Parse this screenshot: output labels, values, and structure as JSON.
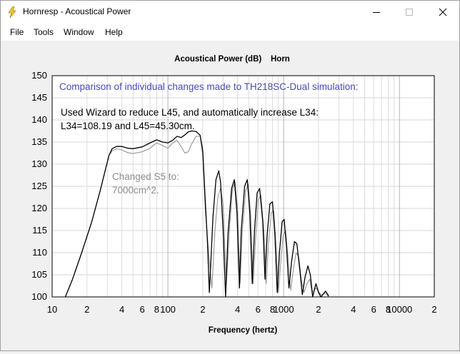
{
  "window": {
    "title": "Hornresp - Acoustical Power",
    "icon": "lightning-bolt-icon",
    "controls": [
      "minimize-icon",
      "maximize-icon",
      "close-icon"
    ]
  },
  "menu": {
    "items": [
      {
        "label": "File"
      },
      {
        "label": "Tools"
      },
      {
        "label": "Window"
      },
      {
        "label": "Help"
      }
    ]
  },
  "chart_data": {
    "type": "line",
    "title": "Acoustical Power (dB)    Horn",
    "xlabel": "Frequency (hertz)",
    "ylabel": "",
    "xscale": "log",
    "xlim": [
      10,
      20000
    ],
    "ylim": [
      100,
      150
    ],
    "grid": true,
    "x_tick_labels": [
      {
        "value": 10,
        "label": "10"
      },
      {
        "value": 20,
        "label": "2"
      },
      {
        "value": 40,
        "label": "4"
      },
      {
        "value": 60,
        "label": "6"
      },
      {
        "value": 80,
        "label": "8"
      },
      {
        "value": 100,
        "label": "100"
      },
      {
        "value": 200,
        "label": "2"
      },
      {
        "value": 400,
        "label": "4"
      },
      {
        "value": 600,
        "label": "6"
      },
      {
        "value": 800,
        "label": "8"
      },
      {
        "value": 1000,
        "label": "1000"
      },
      {
        "value": 2000,
        "label": "2"
      },
      {
        "value": 4000,
        "label": "4"
      },
      {
        "value": 6000,
        "label": "6"
      },
      {
        "value": 8000,
        "label": "8"
      },
      {
        "value": 10000,
        "label": "10000"
      },
      {
        "value": 20000,
        "label": "2"
      }
    ],
    "y_ticks": [
      100,
      105,
      110,
      115,
      120,
      125,
      130,
      135,
      140,
      145,
      150
    ],
    "annotations": {
      "heading": {
        "text": "Comparison of individual changes made to TH218SC-Dual simulation:",
        "color": "#4a4ab8"
      },
      "black_note": {
        "lines": [
          "Used Wizard to reduce L45, and automatically increase L34:",
          "L34=108.19 and L45=45.30cm."
        ],
        "color": "#000000"
      },
      "gray_note": {
        "lines": [
          "Changed S5 to:",
          "7000cm^2."
        ],
        "color": "#8c8c8c"
      }
    },
    "series": [
      {
        "color": "#000000",
        "points": [
          [
            13,
            100
          ],
          [
            15,
            104
          ],
          [
            18,
            110
          ],
          [
            22,
            117
          ],
          [
            26,
            124
          ],
          [
            29,
            129
          ],
          [
            31,
            132
          ],
          [
            33,
            133.5
          ],
          [
            36,
            134
          ],
          [
            40,
            134
          ],
          [
            45,
            133.6
          ],
          [
            50,
            133.5
          ],
          [
            60,
            133.9
          ],
          [
            70,
            134.8
          ],
          [
            80,
            135.5
          ],
          [
            90,
            135
          ],
          [
            100,
            134.8
          ],
          [
            110,
            135.4
          ],
          [
            120,
            136.3
          ],
          [
            130,
            136
          ],
          [
            140,
            136.6
          ],
          [
            150,
            137.3
          ],
          [
            160,
            137.5
          ],
          [
            175,
            137.4
          ],
          [
            190,
            136.5
          ],
          [
            200,
            133
          ],
          [
            210,
            122
          ],
          [
            220,
            112
          ],
          [
            228,
            101
          ],
          [
            235,
            108
          ],
          [
            245,
            118
          ],
          [
            260,
            126.5
          ],
          [
            275,
            128.5
          ],
          [
            285,
            126
          ],
          [
            300,
            115
          ],
          [
            315,
            100
          ],
          [
            330,
            114
          ],
          [
            355,
            124.5
          ],
          [
            375,
            126.5
          ],
          [
            395,
            119
          ],
          [
            415,
            102
          ],
          [
            430,
            115
          ],
          [
            460,
            125
          ],
          [
            485,
            126.5
          ],
          [
            510,
            119
          ],
          [
            535,
            103
          ],
          [
            560,
            115
          ],
          [
            590,
            123.5
          ],
          [
            620,
            124.5
          ],
          [
            660,
            117
          ],
          [
            690,
            104
          ],
          [
            720,
            114
          ],
          [
            760,
            121
          ],
          [
            800,
            121.5
          ],
          [
            840,
            114
          ],
          [
            880,
            101
          ],
          [
            920,
            110
          ],
          [
            970,
            117
          ],
          [
            1010,
            117.5
          ],
          [
            1060,
            111
          ],
          [
            1110,
            102
          ],
          [
            1170,
            108
          ],
          [
            1240,
            112.5
          ],
          [
            1300,
            112
          ],
          [
            1380,
            106
          ],
          [
            1450,
            100.5
          ],
          [
            1530,
            104.5
          ],
          [
            1620,
            107
          ],
          [
            1700,
            105
          ],
          [
            1780,
            100
          ],
          [
            1900,
            103
          ],
          [
            2000,
            101
          ],
          [
            2100,
            100
          ],
          [
            2300,
            101.3
          ],
          [
            2450,
            100.2
          ]
        ]
      },
      {
        "color": "#8c8c8c",
        "points": [
          [
            13,
            100
          ],
          [
            15,
            104
          ],
          [
            18,
            110
          ],
          [
            22,
            117
          ],
          [
            26,
            124
          ],
          [
            29,
            129
          ],
          [
            31,
            132
          ],
          [
            33,
            133
          ],
          [
            36,
            133.5
          ],
          [
            40,
            133.2
          ],
          [
            45,
            132.6
          ],
          [
            50,
            132.4
          ],
          [
            60,
            132.8
          ],
          [
            70,
            133.6
          ],
          [
            80,
            134.8
          ],
          [
            90,
            134.2
          ],
          [
            100,
            133.6
          ],
          [
            110,
            134.8
          ],
          [
            120,
            135.4
          ],
          [
            130,
            134
          ],
          [
            140,
            132.5
          ],
          [
            150,
            132.8
          ],
          [
            160,
            134.5
          ],
          [
            175,
            136.3
          ],
          [
            190,
            136.3
          ],
          [
            200,
            132
          ],
          [
            210,
            120
          ],
          [
            225,
            110
          ],
          [
            240,
            102
          ],
          [
            255,
            115
          ],
          [
            270,
            122.5
          ],
          [
            285,
            124.5
          ],
          [
            300,
            121
          ],
          [
            320,
            103
          ],
          [
            340,
            115
          ],
          [
            360,
            124
          ],
          [
            380,
            126
          ],
          [
            400,
            120
          ],
          [
            420,
            103
          ],
          [
            440,
            115
          ],
          [
            470,
            124
          ],
          [
            495,
            125.5
          ],
          [
            520,
            118
          ],
          [
            545,
            103
          ],
          [
            575,
            114
          ],
          [
            605,
            122
          ],
          [
            635,
            123
          ],
          [
            675,
            115
          ],
          [
            705,
            103
          ],
          [
            740,
            112
          ],
          [
            780,
            119
          ],
          [
            820,
            119.5
          ],
          [
            860,
            112
          ],
          [
            900,
            101
          ],
          [
            945,
            108
          ],
          [
            990,
            114
          ],
          [
            1040,
            115
          ],
          [
            1090,
            109
          ],
          [
            1150,
            101.5
          ],
          [
            1210,
            106
          ],
          [
            1280,
            110
          ],
          [
            1350,
            109
          ],
          [
            1420,
            104
          ],
          [
            1500,
            101
          ],
          [
            1590,
            103
          ],
          [
            1680,
            104
          ],
          [
            1760,
            101
          ],
          [
            1900,
            102
          ],
          [
            2100,
            100.5
          ],
          [
            2300,
            100.8
          ],
          [
            2450,
            100
          ]
        ]
      }
    ]
  }
}
